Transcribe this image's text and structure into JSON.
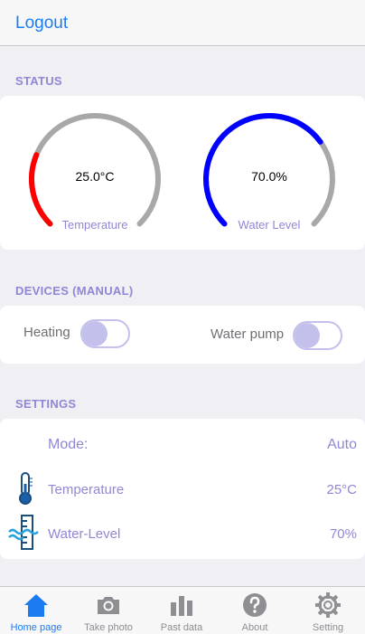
{
  "nav": {
    "logout_label": "Logout"
  },
  "status": {
    "header": "STATUS",
    "temperature": {
      "value_text": "25.0°C",
      "label": "Temperature",
      "fraction": 0.25,
      "color": "#ff0000"
    },
    "water_level": {
      "value_text": "70.0%",
      "label": "Water Level",
      "fraction": 0.7,
      "color": "#0000ff"
    },
    "track_color": "#a8a8a8"
  },
  "devices": {
    "header": "DEVICES (MANUAL)",
    "heating": {
      "label": "Heating",
      "on": false
    },
    "water_pump": {
      "label": "Water pump",
      "on": false
    }
  },
  "settings": {
    "header": "SETTINGS",
    "mode": {
      "label": "Mode:",
      "value": "Auto"
    },
    "temperature": {
      "label": "Temperature",
      "value": "25°C",
      "icon": "thermometer-icon"
    },
    "water_level": {
      "label": "Water-Level",
      "value": "70%",
      "icon": "water-level-icon"
    }
  },
  "tabs": [
    {
      "label": "Home page",
      "icon": "home-icon",
      "active": true
    },
    {
      "label": "Take photo",
      "icon": "camera-icon",
      "active": false
    },
    {
      "label": "Past data",
      "icon": "bar-chart-icon",
      "active": false
    },
    {
      "label": "About",
      "icon": "help-icon",
      "active": false
    },
    {
      "label": "Setting",
      "icon": "gear-icon",
      "active": false
    }
  ],
  "colors": {
    "accent": "#1b7cf2",
    "label": "#8f87d6",
    "toggle": "#c4c0ec"
  }
}
